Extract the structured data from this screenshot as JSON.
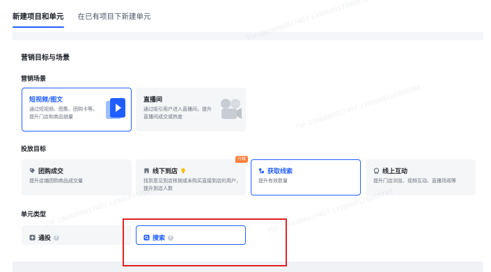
{
  "tabs": [
    {
      "label": "新建项目和单元",
      "active": true
    },
    {
      "label": "在已有项目下新建单元",
      "active": false
    }
  ],
  "marketing": {
    "section_title": "营销目标与场景",
    "scene_title": "营销场景",
    "scenes": [
      {
        "title": "短视频/图文",
        "desc": "通过短视频、图集、团购卡等，提升门店和商品销量",
        "icon": "video-doc-icon",
        "selected": true
      },
      {
        "title": "直播间",
        "desc": "通过吸引用户进入直播间，提升直播间成交或热度",
        "icon": "live-room-icon",
        "selected": false
      }
    ],
    "goal_title": "投放目标",
    "goals": [
      {
        "title": "团购成交",
        "desc": "提升店铺团购商品成交量",
        "icon": "tag-icon",
        "selected": false
      },
      {
        "title": "线下到店",
        "desc": "找到意见到店核销或未购买直接到店的用户，提升到店人数",
        "icon": "store-icon",
        "selected": false,
        "badge": "升级"
      },
      {
        "title": "获取线索",
        "desc": "提升有效数量",
        "icon": "leads-icon",
        "selected": true
      },
      {
        "title": "线上互动",
        "desc": "提升门店浏览、视频互动、直播场观等",
        "icon": "interaction-icon",
        "selected": false
      }
    ],
    "unit_title": "单元类型",
    "units": [
      {
        "title": "通投",
        "icon": "broad-icon",
        "selected": false
      },
      {
        "title": "搜索",
        "icon": "search-icon",
        "selected": true
      }
    ]
  },
  "colors": {
    "accent": "#1f5eff",
    "highlight": "#e02020",
    "badge": "#ff7d3a"
  },
  "watermark": "TSF-2866886017407\n1398689126868768"
}
